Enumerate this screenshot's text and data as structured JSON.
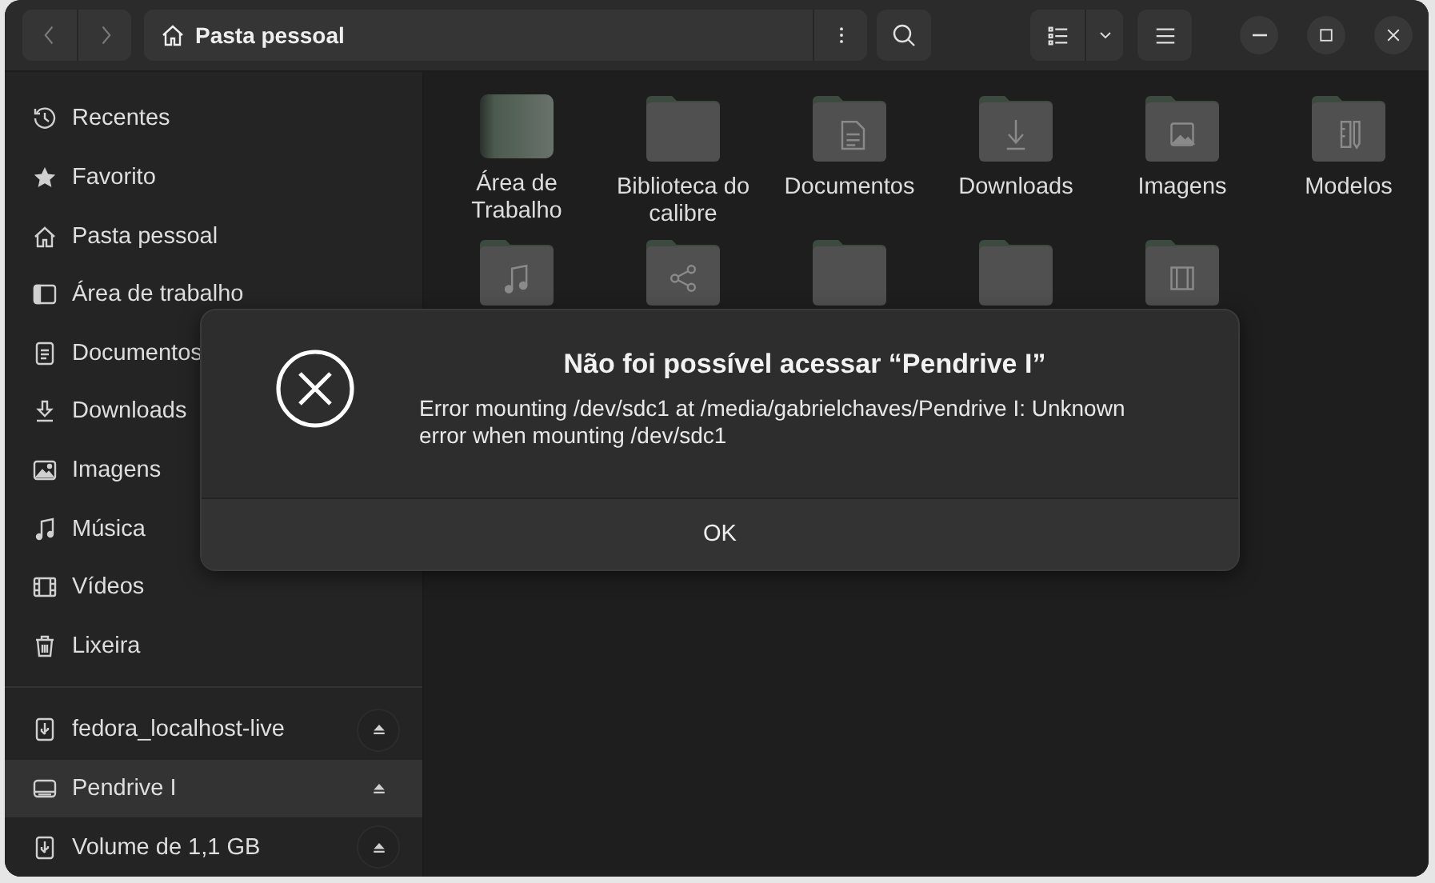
{
  "window": {
    "title": "Pasta pessoal"
  },
  "sidebar": {
    "places": [
      {
        "label": "Recentes",
        "kind": "recent",
        "selected": false
      },
      {
        "label": "Favorito",
        "kind": "starred",
        "selected": false
      },
      {
        "label": "Pasta pessoal",
        "kind": "home",
        "selected": false
      },
      {
        "label": "Área de trabalho",
        "kind": "desktop",
        "selected": false
      },
      {
        "label": "Documentos",
        "kind": "documents",
        "selected": false
      },
      {
        "label": "Downloads",
        "kind": "downloads",
        "selected": false
      },
      {
        "label": "Imagens",
        "kind": "pictures",
        "selected": false
      },
      {
        "label": "Música",
        "kind": "music",
        "selected": false
      },
      {
        "label": "Vídeos",
        "kind": "videos",
        "selected": false
      },
      {
        "label": "Lixeira",
        "kind": "trash",
        "selected": false
      }
    ],
    "devices": [
      {
        "label": "fedora_localhost-live",
        "kind": "usb",
        "selected": false
      },
      {
        "label": "Pendrive I",
        "kind": "drive",
        "selected": true
      },
      {
        "label": "Volume de 1,1 GB",
        "kind": "usb",
        "selected": false
      }
    ]
  },
  "folders": [
    {
      "name": "Área de Trabalho",
      "kind": "desktop"
    },
    {
      "name": "Biblioteca do calibre",
      "kind": "plain"
    },
    {
      "name": "Documentos",
      "kind": "documents"
    },
    {
      "name": "Downloads",
      "kind": "downloads"
    },
    {
      "name": "Imagens",
      "kind": "pictures"
    },
    {
      "name": "Modelos",
      "kind": "templates"
    },
    {
      "kind": "music"
    },
    {
      "kind": "public"
    },
    {
      "kind": "plain"
    },
    {
      "kind": "plain"
    },
    {
      "kind": "videos"
    }
  ],
  "dialog": {
    "title": "Não foi possível acessar “Pendrive I”",
    "message": "Error mounting /dev/sdc1 at /media/gabrielchaves/Pendrive I: Unknown error when mounting /dev/sdc1",
    "buttons": [
      "OK"
    ]
  }
}
